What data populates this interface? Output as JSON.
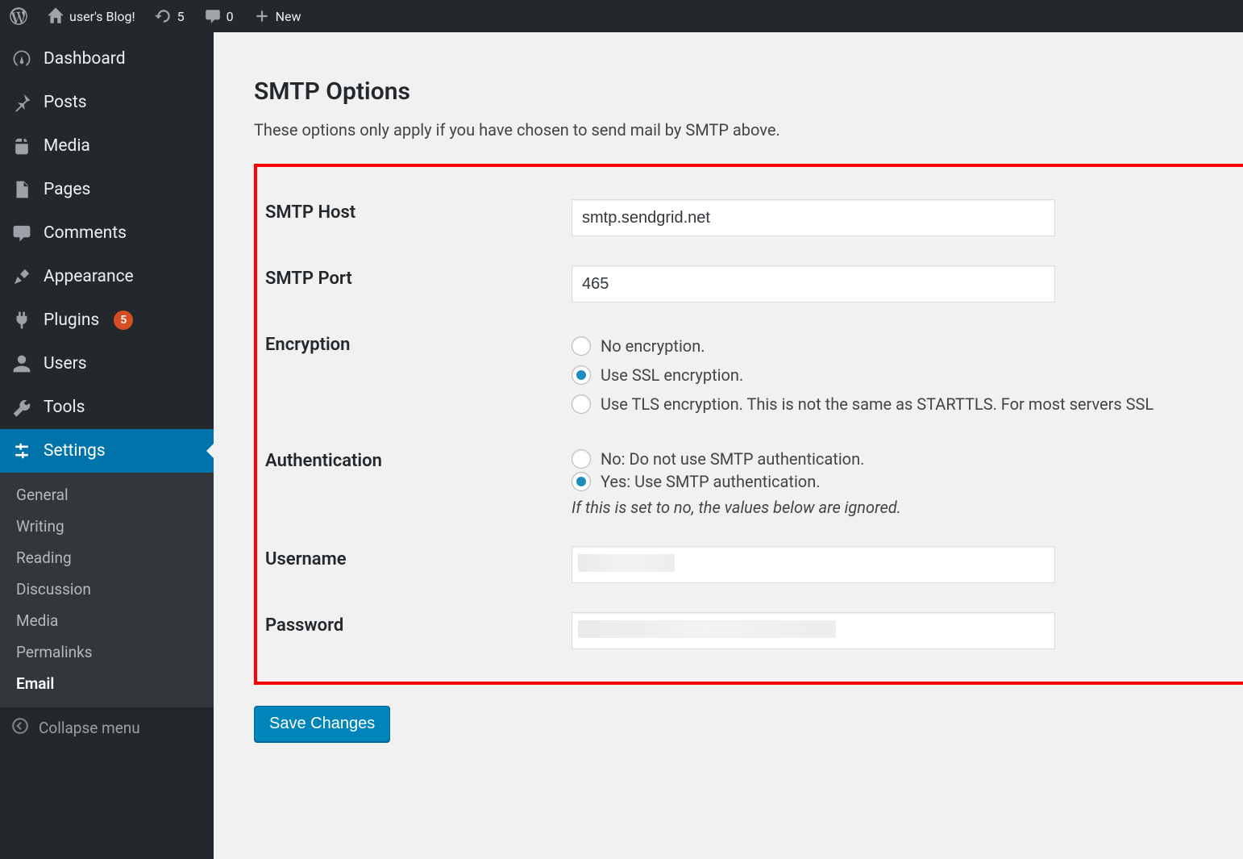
{
  "adminbar": {
    "site_title": "user's Blog!",
    "updates_count": "5",
    "comments_count": "0",
    "new_label": "New"
  },
  "sidebar": {
    "items": [
      {
        "label": "Dashboard"
      },
      {
        "label": "Posts"
      },
      {
        "label": "Media"
      },
      {
        "label": "Pages"
      },
      {
        "label": "Comments"
      },
      {
        "label": "Appearance"
      },
      {
        "label": "Plugins",
        "badge": "5"
      },
      {
        "label": "Users"
      },
      {
        "label": "Tools"
      },
      {
        "label": "Settings"
      }
    ],
    "submenu": [
      {
        "label": "General"
      },
      {
        "label": "Writing"
      },
      {
        "label": "Reading"
      },
      {
        "label": "Discussion"
      },
      {
        "label": "Media"
      },
      {
        "label": "Permalinks"
      },
      {
        "label": "Email"
      }
    ],
    "collapse_label": "Collapse menu"
  },
  "page": {
    "section_title": "SMTP Options",
    "section_desc": "These options only apply if you have chosen to send mail by SMTP above.",
    "fields": {
      "smtp_host_label": "SMTP Host",
      "smtp_host_value": "smtp.sendgrid.net",
      "smtp_port_label": "SMTP Port",
      "smtp_port_value": "465",
      "encryption_label": "Encryption",
      "encryption_options": {
        "none": "No encryption.",
        "ssl": "Use SSL encryption.",
        "tls": "Use TLS encryption. This is not the same as STARTTLS. For most servers SSL"
      },
      "encryption_selected": "ssl",
      "auth_label": "Authentication",
      "auth_options": {
        "no": "No: Do not use SMTP authentication.",
        "yes": "Yes: Use SMTP authentication."
      },
      "auth_selected": "yes",
      "auth_hint": "If this is set to no, the values below are ignored.",
      "username_label": "Username",
      "username_value": "",
      "password_label": "Password",
      "password_value": ""
    },
    "save_label": "Save Changes"
  }
}
